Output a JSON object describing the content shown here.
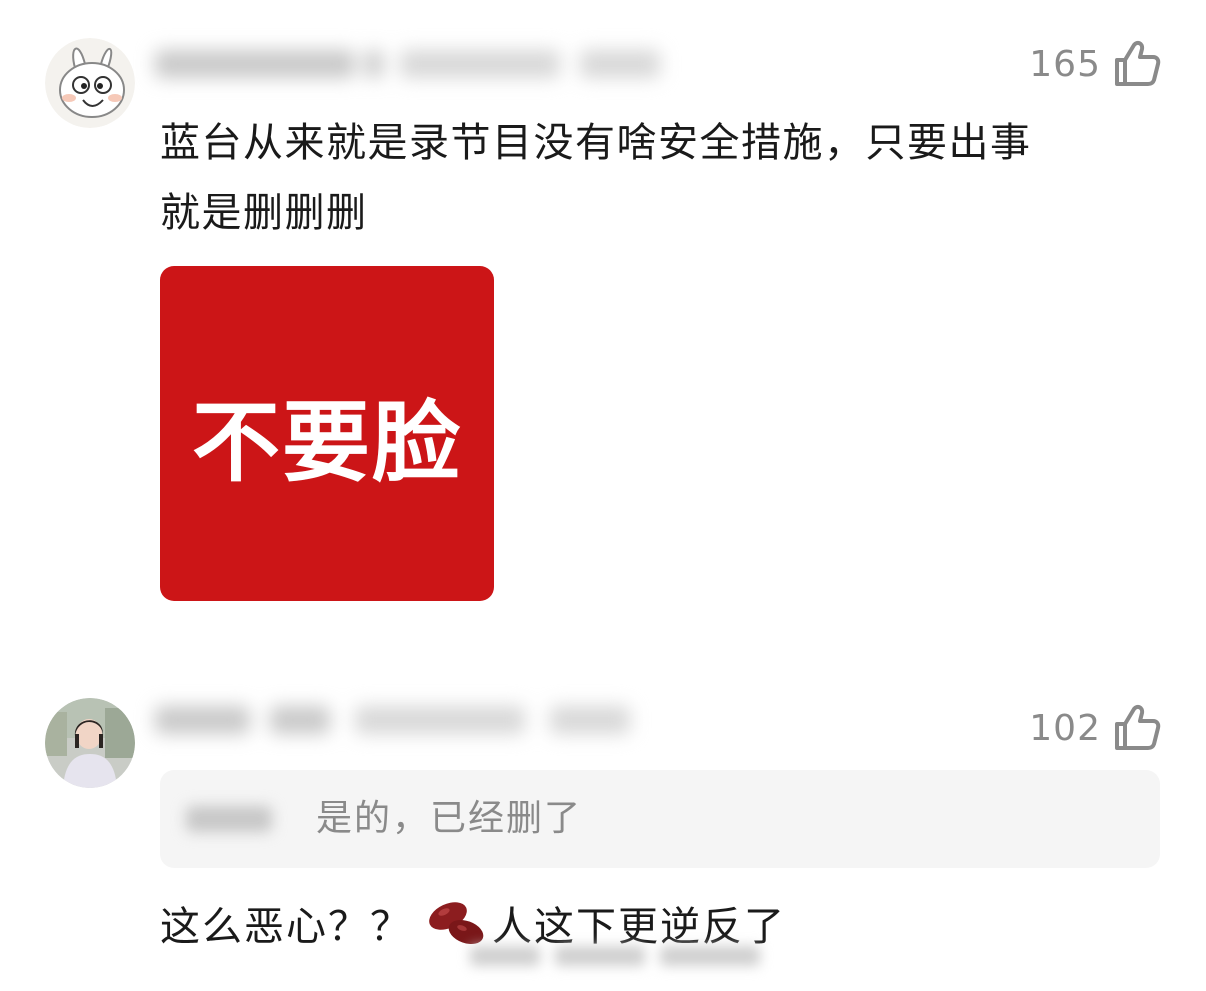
{
  "comments": [
    {
      "likes": "165",
      "text_line1": "蓝台从来就是录节目没有啥安全措施，只要出事",
      "text_line2": "就是删删删",
      "sticker_text": "不要脸"
    },
    {
      "likes": "102",
      "quote_text": "是的，已经删了",
      "reply_text_before_emoji": "这么恶心？？",
      "reply_text_after_emoji": "人这下更逆反了"
    }
  ],
  "icons": {
    "like": "thumbs-up-icon",
    "emoji": "beans-emoji-icon"
  },
  "colors": {
    "sticker_bg": "#cc1517",
    "muted_text": "#8a8a8a",
    "quote_bg": "#f5f5f5"
  }
}
